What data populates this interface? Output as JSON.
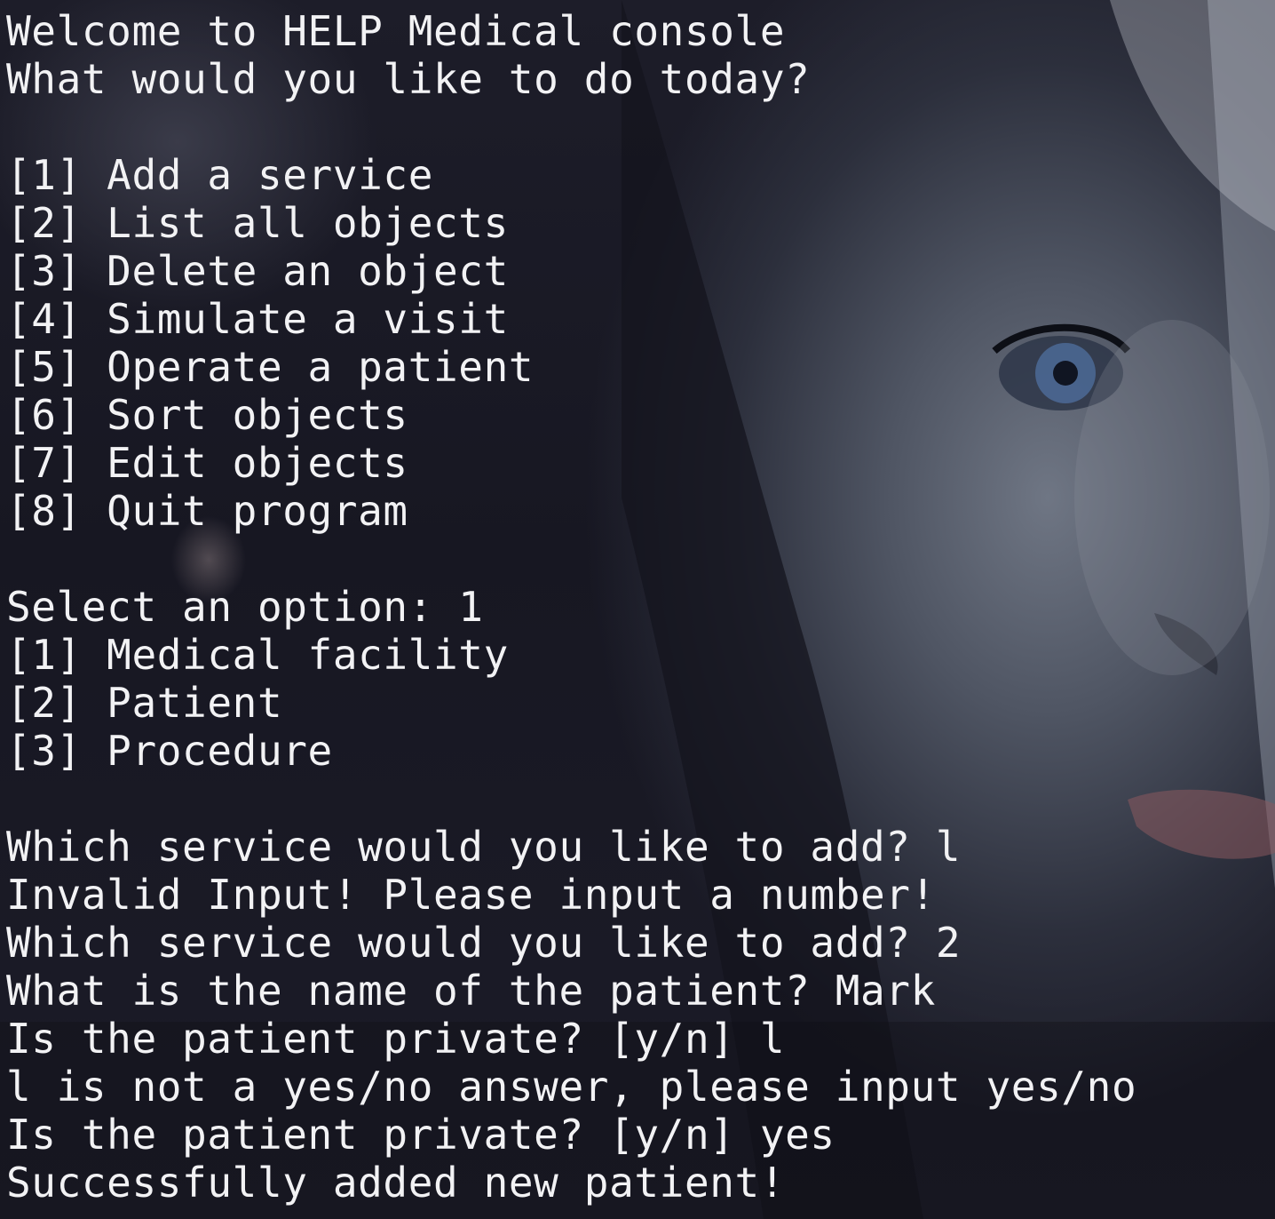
{
  "header": {
    "welcome": "Welcome to HELP Medical console",
    "question": "What would you like to do today?"
  },
  "main_menu": [
    "[1] Add a service",
    "[2] List all objects",
    "[3] Delete an object",
    "[4] Simulate a visit",
    "[5] Operate a patient",
    "[6] Sort objects",
    "[7] Edit objects",
    "[8] Quit program"
  ],
  "select_prompt": "Select an option: 1",
  "service_menu": [
    "[1] Medical facility",
    "[2] Patient",
    "[3] Procedure"
  ],
  "session_log": [
    "Which service would you like to add? l",
    "Invalid Input! Please input a number!",
    "Which service would you like to add? 2",
    "What is the name of the patient? Mark",
    "Is the patient private? [y/n] l",
    "l is not a yes/no answer, please input yes/no",
    "Is the patient private? [y/n] yes",
    "Successfully added new patient!"
  ],
  "colors": {
    "text": "#f2f2f4",
    "background": "#15151f"
  }
}
